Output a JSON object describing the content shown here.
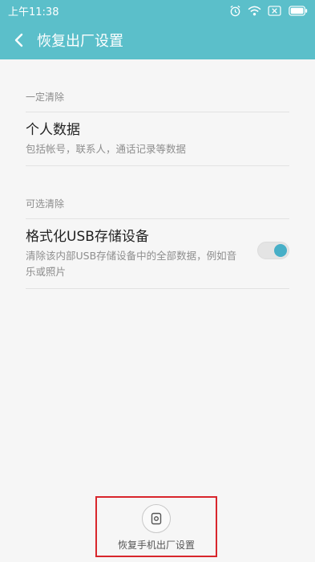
{
  "status_bar": {
    "time": "上午11:38",
    "icons": [
      "alarm-icon",
      "wifi-icon",
      "sim-off-icon",
      "battery-icon"
    ]
  },
  "app_bar": {
    "title": "恢复出厂设置",
    "back_icon": "chevron-left-icon"
  },
  "sections": [
    {
      "label": "一定清除",
      "item": {
        "title": "个人数据",
        "subtitle": "包括帐号，联系人，通话记录等数据"
      }
    },
    {
      "label": "可选清除",
      "item": {
        "title": "格式化USB存储设备",
        "subtitle": "清除该内部USB存储设备中的全部数据，例如音乐或照片",
        "toggle_on": true
      }
    }
  ],
  "bottom_action": {
    "label": "恢复手机出厂设置",
    "icon": "reset-phone-icon"
  },
  "colors": {
    "accent": "#5bbfca",
    "toggle_knob": "#47afc7",
    "highlight_box": "#d8262c"
  }
}
